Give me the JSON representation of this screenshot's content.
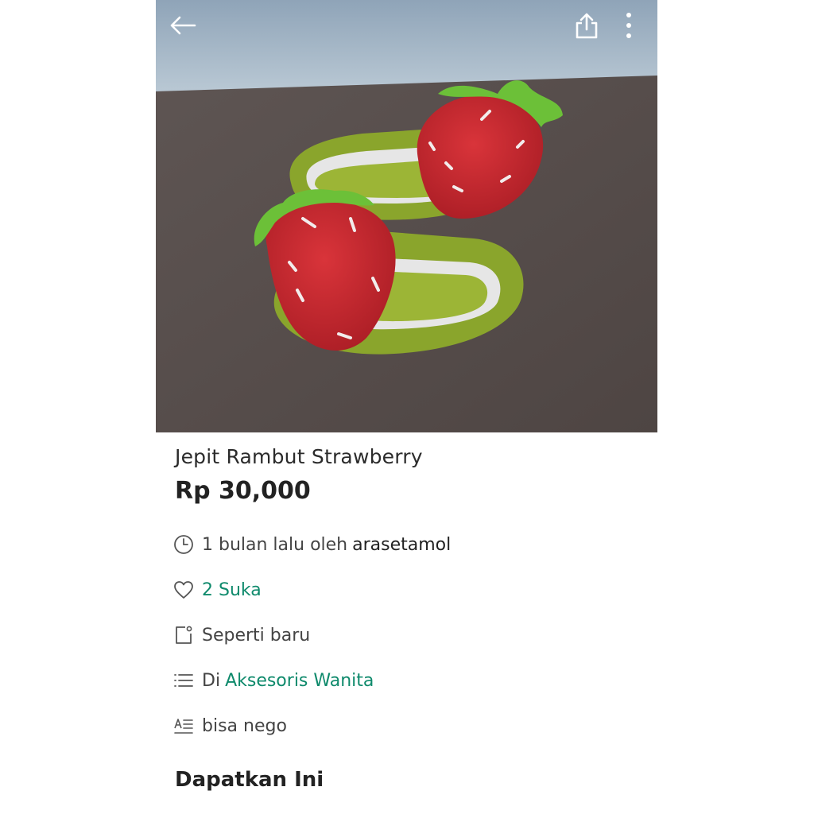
{
  "header": {
    "back_icon": "arrow-left-icon",
    "share_icon": "share-icon",
    "more_icon": "more-vertical-icon"
  },
  "product": {
    "title": "Jepit Rambut Strawberry",
    "price": "Rp 30,000",
    "posted_time": "1 bulan lalu oleh",
    "seller": "arasetamol",
    "likes": "2 Suka",
    "condition": "Seperti baru",
    "category_prefix": "Di",
    "category": "Aksesoris Wanita",
    "description": "bisa nego"
  },
  "section": {
    "get_this": "Dapatkan Ini"
  },
  "colors": {
    "accent": "#0f8a6c",
    "text": "#222222"
  }
}
